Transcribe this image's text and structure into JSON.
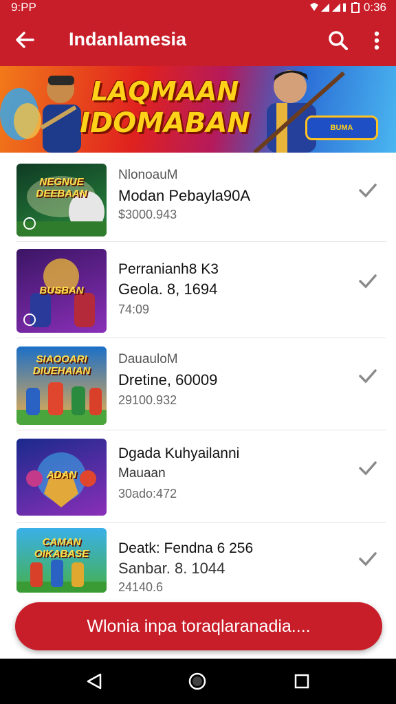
{
  "status": {
    "time": "9:PP",
    "clock": "0:36"
  },
  "app": {
    "title": "Indanlamesia"
  },
  "banner": {
    "line1": "LAQMAAN",
    "line2": "IDOMABAN",
    "pill_text": "BUMA"
  },
  "items": [
    {
      "thumb_text": "NEGNUE DEEBAAN",
      "line1": "NlonoauМ",
      "line2": "Modan Pebayla90A",
      "line3": "$3000.943",
      "thumb_colors": [
        "#0f3b24",
        "#2a8a3e"
      ]
    },
    {
      "thumb_text": "BUSBAN",
      "line1": "",
      "line2a": "Perranianh8 K3",
      "line2": "Geola. 8, 1694",
      "line3": "74:09",
      "thumb_colors": [
        "#3b1565",
        "#8a2fb8"
      ]
    },
    {
      "thumb_text": "SIAOOARI DIUEHAIAN",
      "line1": "DauauloM",
      "line2": "Dretine, 60009",
      "line3": "29100.932",
      "thumb_colors": [
        "#1c6fc7",
        "#f0b04a"
      ]
    },
    {
      "thumb_text": "ADAN",
      "line1": "",
      "line2a": "Dgada Kuhyailanni",
      "line2": "Mauaan",
      "line3": "30ado:472",
      "thumb_colors": [
        "#1a2a8c",
        "#8a2fb8"
      ]
    },
    {
      "thumb_text": "CAMAN OIKABASE",
      "line1": "",
      "line2a": "Deatk: Fendna 6 256",
      "line2": "Sanbar. 8. 1044",
      "line3": "24140.6",
      "thumb_colors": [
        "#3ab0e8",
        "#46b04a"
      ]
    }
  ],
  "cta": {
    "label": "Wlonia inpa toraqlaranadia...."
  },
  "colors": {
    "primary": "#c81e2a",
    "accent": "#ffd21a"
  }
}
